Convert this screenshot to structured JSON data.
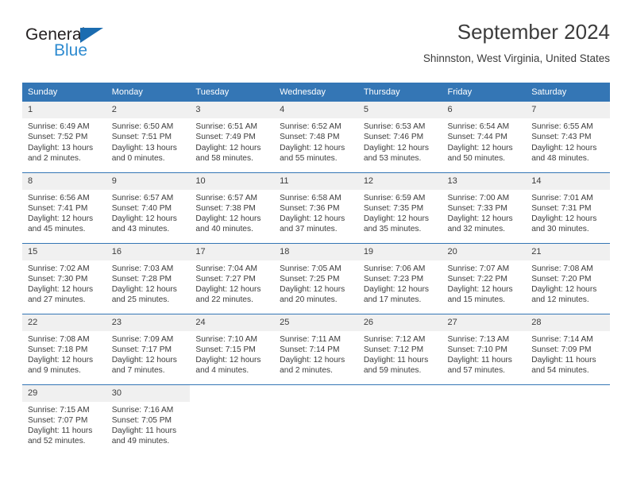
{
  "logo": {
    "word_top": "General",
    "word_bottom": "Blue",
    "triangle_color": "#1b6cb0",
    "blue_text_color": "#2e8bd0"
  },
  "header": {
    "title": "September 2024",
    "location": "Shinnston, West Virginia, United States"
  },
  "theme": {
    "header_bar": "#3476b5",
    "daynum_band": "#f0f0f0",
    "text": "#3c3c3c"
  },
  "weekdays": [
    "Sunday",
    "Monday",
    "Tuesday",
    "Wednesday",
    "Thursday",
    "Friday",
    "Saturday"
  ],
  "labels": {
    "sunrise_prefix": "Sunrise:",
    "sunset_prefix": "Sunset:",
    "daylight_prefix": "Daylight:"
  },
  "weeks": [
    [
      {
        "day": "1",
        "sunrise": "Sunrise: 6:49 AM",
        "sunset": "Sunset: 7:52 PM",
        "daylight": "Daylight: 13 hours and 2 minutes."
      },
      {
        "day": "2",
        "sunrise": "Sunrise: 6:50 AM",
        "sunset": "Sunset: 7:51 PM",
        "daylight": "Daylight: 13 hours and 0 minutes."
      },
      {
        "day": "3",
        "sunrise": "Sunrise: 6:51 AM",
        "sunset": "Sunset: 7:49 PM",
        "daylight": "Daylight: 12 hours and 58 minutes."
      },
      {
        "day": "4",
        "sunrise": "Sunrise: 6:52 AM",
        "sunset": "Sunset: 7:48 PM",
        "daylight": "Daylight: 12 hours and 55 minutes."
      },
      {
        "day": "5",
        "sunrise": "Sunrise: 6:53 AM",
        "sunset": "Sunset: 7:46 PM",
        "daylight": "Daylight: 12 hours and 53 minutes."
      },
      {
        "day": "6",
        "sunrise": "Sunrise: 6:54 AM",
        "sunset": "Sunset: 7:44 PM",
        "daylight": "Daylight: 12 hours and 50 minutes."
      },
      {
        "day": "7",
        "sunrise": "Sunrise: 6:55 AM",
        "sunset": "Sunset: 7:43 PM",
        "daylight": "Daylight: 12 hours and 48 minutes."
      }
    ],
    [
      {
        "day": "8",
        "sunrise": "Sunrise: 6:56 AM",
        "sunset": "Sunset: 7:41 PM",
        "daylight": "Daylight: 12 hours and 45 minutes."
      },
      {
        "day": "9",
        "sunrise": "Sunrise: 6:57 AM",
        "sunset": "Sunset: 7:40 PM",
        "daylight": "Daylight: 12 hours and 43 minutes."
      },
      {
        "day": "10",
        "sunrise": "Sunrise: 6:57 AM",
        "sunset": "Sunset: 7:38 PM",
        "daylight": "Daylight: 12 hours and 40 minutes."
      },
      {
        "day": "11",
        "sunrise": "Sunrise: 6:58 AM",
        "sunset": "Sunset: 7:36 PM",
        "daylight": "Daylight: 12 hours and 37 minutes."
      },
      {
        "day": "12",
        "sunrise": "Sunrise: 6:59 AM",
        "sunset": "Sunset: 7:35 PM",
        "daylight": "Daylight: 12 hours and 35 minutes."
      },
      {
        "day": "13",
        "sunrise": "Sunrise: 7:00 AM",
        "sunset": "Sunset: 7:33 PM",
        "daylight": "Daylight: 12 hours and 32 minutes."
      },
      {
        "day": "14",
        "sunrise": "Sunrise: 7:01 AM",
        "sunset": "Sunset: 7:31 PM",
        "daylight": "Daylight: 12 hours and 30 minutes."
      }
    ],
    [
      {
        "day": "15",
        "sunrise": "Sunrise: 7:02 AM",
        "sunset": "Sunset: 7:30 PM",
        "daylight": "Daylight: 12 hours and 27 minutes."
      },
      {
        "day": "16",
        "sunrise": "Sunrise: 7:03 AM",
        "sunset": "Sunset: 7:28 PM",
        "daylight": "Daylight: 12 hours and 25 minutes."
      },
      {
        "day": "17",
        "sunrise": "Sunrise: 7:04 AM",
        "sunset": "Sunset: 7:27 PM",
        "daylight": "Daylight: 12 hours and 22 minutes."
      },
      {
        "day": "18",
        "sunrise": "Sunrise: 7:05 AM",
        "sunset": "Sunset: 7:25 PM",
        "daylight": "Daylight: 12 hours and 20 minutes."
      },
      {
        "day": "19",
        "sunrise": "Sunrise: 7:06 AM",
        "sunset": "Sunset: 7:23 PM",
        "daylight": "Daylight: 12 hours and 17 minutes."
      },
      {
        "day": "20",
        "sunrise": "Sunrise: 7:07 AM",
        "sunset": "Sunset: 7:22 PM",
        "daylight": "Daylight: 12 hours and 15 minutes."
      },
      {
        "day": "21",
        "sunrise": "Sunrise: 7:08 AM",
        "sunset": "Sunset: 7:20 PM",
        "daylight": "Daylight: 12 hours and 12 minutes."
      }
    ],
    [
      {
        "day": "22",
        "sunrise": "Sunrise: 7:08 AM",
        "sunset": "Sunset: 7:18 PM",
        "daylight": "Daylight: 12 hours and 9 minutes."
      },
      {
        "day": "23",
        "sunrise": "Sunrise: 7:09 AM",
        "sunset": "Sunset: 7:17 PM",
        "daylight": "Daylight: 12 hours and 7 minutes."
      },
      {
        "day": "24",
        "sunrise": "Sunrise: 7:10 AM",
        "sunset": "Sunset: 7:15 PM",
        "daylight": "Daylight: 12 hours and 4 minutes."
      },
      {
        "day": "25",
        "sunrise": "Sunrise: 7:11 AM",
        "sunset": "Sunset: 7:14 PM",
        "daylight": "Daylight: 12 hours and 2 minutes."
      },
      {
        "day": "26",
        "sunrise": "Sunrise: 7:12 AM",
        "sunset": "Sunset: 7:12 PM",
        "daylight": "Daylight: 11 hours and 59 minutes."
      },
      {
        "day": "27",
        "sunrise": "Sunrise: 7:13 AM",
        "sunset": "Sunset: 7:10 PM",
        "daylight": "Daylight: 11 hours and 57 minutes."
      },
      {
        "day": "28",
        "sunrise": "Sunrise: 7:14 AM",
        "sunset": "Sunset: 7:09 PM",
        "daylight": "Daylight: 11 hours and 54 minutes."
      }
    ],
    [
      {
        "day": "29",
        "sunrise": "Sunrise: 7:15 AM",
        "sunset": "Sunset: 7:07 PM",
        "daylight": "Daylight: 11 hours and 52 minutes."
      },
      {
        "day": "30",
        "sunrise": "Sunrise: 7:16 AM",
        "sunset": "Sunset: 7:05 PM",
        "daylight": "Daylight: 11 hours and 49 minutes."
      },
      {
        "day": "",
        "sunrise": "",
        "sunset": "",
        "daylight": ""
      },
      {
        "day": "",
        "sunrise": "",
        "sunset": "",
        "daylight": ""
      },
      {
        "day": "",
        "sunrise": "",
        "sunset": "",
        "daylight": ""
      },
      {
        "day": "",
        "sunrise": "",
        "sunset": "",
        "daylight": ""
      },
      {
        "day": "",
        "sunrise": "",
        "sunset": "",
        "daylight": ""
      }
    ]
  ]
}
